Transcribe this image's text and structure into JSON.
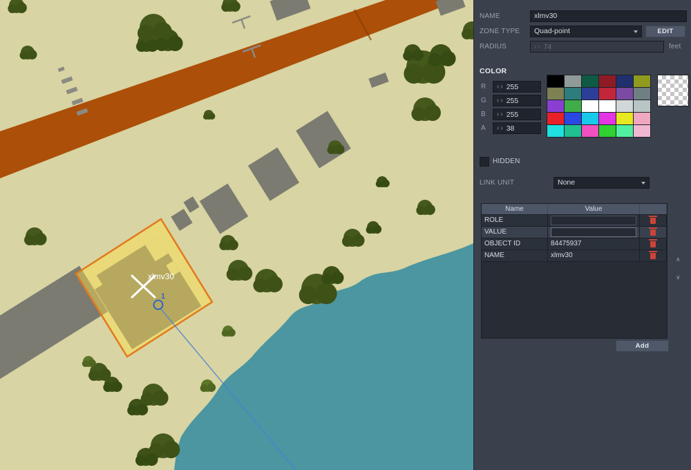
{
  "map": {
    "zone_label": "xlmv30",
    "point_label": "1",
    "colors": {
      "land": "#d8d4a3",
      "road": "#ac4f08",
      "water": "#4b96a1",
      "building": "#7b7b71",
      "zone_fill": "#ffe046",
      "zone_border": "#e2791c",
      "marker": "#ffffff",
      "point": "#2f63c9"
    }
  },
  "panel": {
    "fields": {
      "name_label": "NAME",
      "name_value": "xlmv30",
      "zone_type_label": "ZONE TYPE",
      "zone_type_value": "Quad-point",
      "edit_button": "EDIT",
      "radius_label": "RADIUS",
      "radius_value": "74",
      "radius_unit": "feet"
    },
    "color": {
      "header": "COLOR",
      "channels": [
        {
          "label": "R",
          "value": "255"
        },
        {
          "label": "G",
          "value": "255"
        },
        {
          "label": "B",
          "value": "255"
        },
        {
          "label": "A",
          "value": "38"
        }
      ],
      "palette": [
        [
          "#000000",
          "#8f9a99",
          "#0f5a44",
          "#8e1b24",
          "#20306e",
          "#8f9a1f"
        ],
        [
          "#7d8154",
          "#2e7d7c",
          "#2b3f98",
          "#c2263a",
          "#7b4aa2",
          "#6f7f84"
        ],
        [
          "#8a3fd2",
          "#3fae49",
          "#ffffff",
          "#ffffff",
          "#d2d8d8",
          "#b9c4c4"
        ],
        [
          "#e82028",
          "#2b48e2",
          "#19c9ea",
          "#e435e4",
          "#e8e820",
          "#f0a8c0"
        ],
        [
          "#20e0e0",
          "#20c090",
          "#f050c0",
          "#30d030",
          "#50f0a0",
          "#f0b8d0"
        ]
      ]
    },
    "hidden_label": "HIDDEN",
    "link_unit_label": "LINK UNIT",
    "link_unit_value": "None",
    "table": {
      "headers": [
        "Name",
        "Value"
      ],
      "rows": [
        {
          "name": "ROLE",
          "value": ""
        },
        {
          "name": "VALUE",
          "value": ""
        },
        {
          "name": "OBJECT ID",
          "value": "84475937"
        },
        {
          "name": "NAME",
          "value": "xlmv30"
        }
      ],
      "add_button": "Add"
    }
  }
}
